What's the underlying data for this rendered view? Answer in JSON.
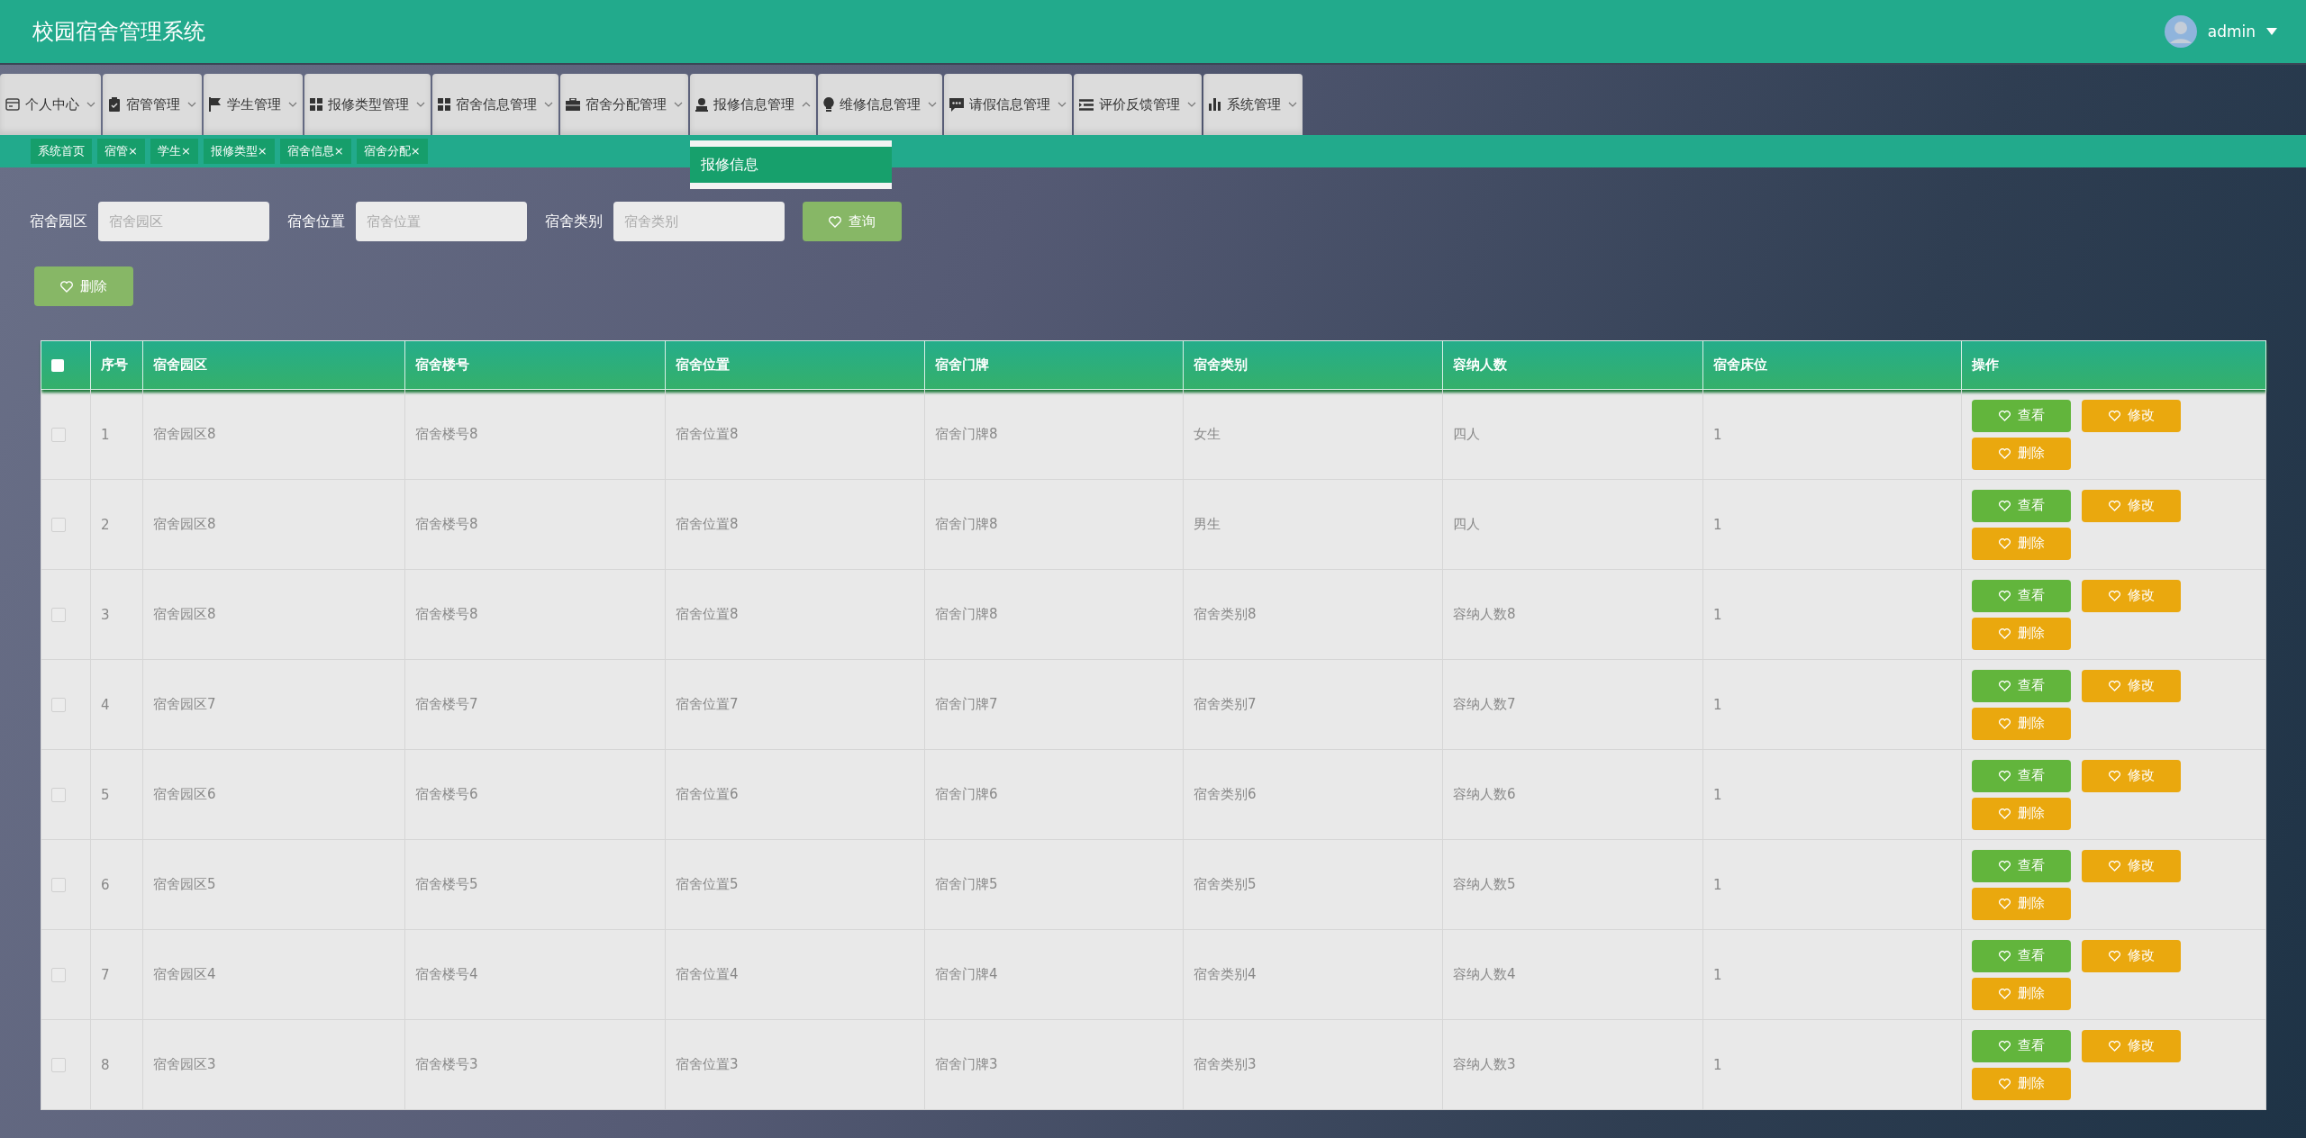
{
  "header": {
    "title": "校园宿舍管理系统",
    "user": "admin"
  },
  "nav": [
    {
      "label": "个人中心",
      "kind": "card",
      "expanded": false
    },
    {
      "label": "宿管管理",
      "kind": "clipboard",
      "expanded": false
    },
    {
      "label": "学生管理",
      "kind": "flag",
      "expanded": false
    },
    {
      "label": "报修类型管理",
      "kind": "grid",
      "expanded": false
    },
    {
      "label": "宿舍信息管理",
      "kind": "grid",
      "expanded": false
    },
    {
      "label": "宿舍分配管理",
      "kind": "briefcase",
      "expanded": false
    },
    {
      "label": "报修信息管理",
      "kind": "person",
      "expanded": true,
      "menu": [
        "报修信息"
      ]
    },
    {
      "label": "维修信息管理",
      "kind": "bulb",
      "expanded": false
    },
    {
      "label": "请假信息管理",
      "kind": "chat",
      "expanded": false
    },
    {
      "label": "评价反馈管理",
      "kind": "list",
      "expanded": false
    },
    {
      "label": "系统管理",
      "kind": "chart",
      "expanded": false
    }
  ],
  "tags": [
    {
      "label": "系统首页"
    },
    {
      "label": "宿管",
      "close": "×"
    },
    {
      "label": "学生",
      "close": "×"
    },
    {
      "label": "报修类型",
      "close": "×"
    },
    {
      "label": "宿舍信息",
      "close": "×"
    },
    {
      "label": "宿舍分配",
      "close": "×"
    }
  ],
  "search": {
    "fields": [
      {
        "label": "宿舍园区",
        "placeholder": "宿舍园区"
      },
      {
        "label": "宿舍位置",
        "placeholder": "宿舍位置"
      },
      {
        "label": "宿舍类别",
        "placeholder": "宿舍类别"
      }
    ],
    "button": "查询"
  },
  "delete_button": "删除",
  "table": {
    "select_all_checked": false,
    "columns": [
      "序号",
      "宿舍园区",
      "宿舍楼号",
      "宿舍位置",
      "宿舍门牌",
      "宿舍类别",
      "容纳人数",
      "宿舍床位",
      "操作"
    ],
    "rows": [
      {
        "checked": false,
        "cells": [
          "1",
          "宿舍园区8",
          "宿舍楼号8",
          "宿舍位置8",
          "宿舍门牌8",
          "女生",
          "四人",
          "1"
        ],
        "actions": [
          {
            "kind": "view",
            "label": "查看"
          },
          {
            "kind": "edit",
            "label": "修改"
          },
          {
            "kind": "delete",
            "label": "删除"
          }
        ]
      },
      {
        "checked": false,
        "cells": [
          "2",
          "宿舍园区8",
          "宿舍楼号8",
          "宿舍位置8",
          "宿舍门牌8",
          "男生",
          "四人",
          "1"
        ],
        "actions": [
          {
            "kind": "view",
            "label": "查看"
          },
          {
            "kind": "edit",
            "label": "修改"
          },
          {
            "kind": "delete",
            "label": "删除"
          }
        ]
      },
      {
        "checked": false,
        "cells": [
          "3",
          "宿舍园区8",
          "宿舍楼号8",
          "宿舍位置8",
          "宿舍门牌8",
          "宿舍类别8",
          "容纳人数8",
          "1"
        ],
        "actions": [
          {
            "kind": "view",
            "label": "查看"
          },
          {
            "kind": "edit",
            "label": "修改"
          },
          {
            "kind": "delete",
            "label": "删除"
          }
        ]
      },
      {
        "checked": false,
        "cells": [
          "4",
          "宿舍园区7",
          "宿舍楼号7",
          "宿舍位置7",
          "宿舍门牌7",
          "宿舍类别7",
          "容纳人数7",
          "1"
        ],
        "actions": [
          {
            "kind": "view",
            "label": "查看"
          },
          {
            "kind": "edit",
            "label": "修改"
          },
          {
            "kind": "delete",
            "label": "删除"
          }
        ]
      },
      {
        "checked": false,
        "cells": [
          "5",
          "宿舍园区6",
          "宿舍楼号6",
          "宿舍位置6",
          "宿舍门牌6",
          "宿舍类别6",
          "容纳人数6",
          "1"
        ],
        "actions": [
          {
            "kind": "view",
            "label": "查看"
          },
          {
            "kind": "edit",
            "label": "修改"
          },
          {
            "kind": "delete",
            "label": "删除"
          }
        ]
      },
      {
        "checked": false,
        "cells": [
          "6",
          "宿舍园区5",
          "宿舍楼号5",
          "宿舍位置5",
          "宿舍门牌5",
          "宿舍类别5",
          "容纳人数5",
          "1"
        ],
        "actions": [
          {
            "kind": "view",
            "label": "查看"
          },
          {
            "kind": "edit",
            "label": "修改"
          },
          {
            "kind": "delete",
            "label": "删除"
          }
        ]
      },
      {
        "checked": false,
        "cells": [
          "7",
          "宿舍园区4",
          "宿舍楼号4",
          "宿舍位置4",
          "宿舍门牌4",
          "宿舍类别4",
          "容纳人数4",
          "1"
        ],
        "actions": [
          {
            "kind": "view",
            "label": "查看"
          },
          {
            "kind": "edit",
            "label": "修改"
          },
          {
            "kind": "delete",
            "label": "删除"
          }
        ]
      },
      {
        "checked": false,
        "cells": [
          "8",
          "宿舍园区3",
          "宿舍楼号3",
          "宿舍位置3",
          "宿舍门牌3",
          "宿舍类别3",
          "容纳人数3",
          "1"
        ],
        "actions": [
          {
            "kind": "view",
            "label": "查看"
          },
          {
            "kind": "edit",
            "label": "修改"
          },
          {
            "kind": "delete",
            "label": "删除"
          }
        ]
      }
    ]
  }
}
